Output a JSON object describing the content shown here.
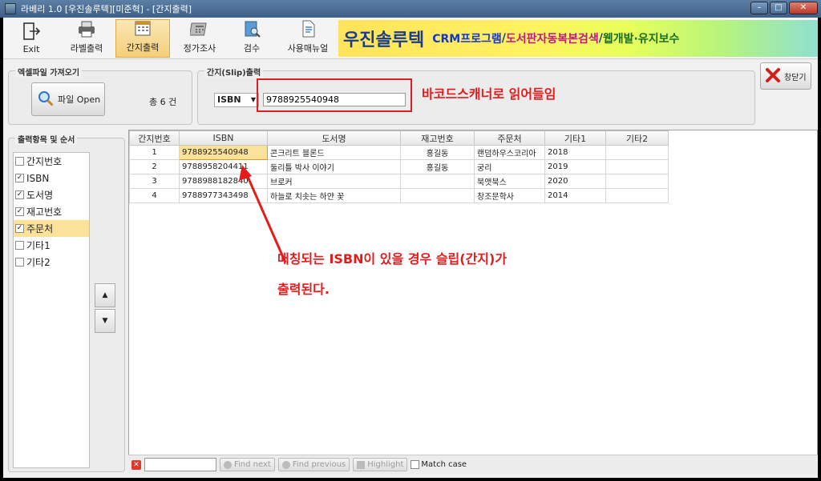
{
  "window": {
    "title": "라베리 1.0 [우진솔루텍][미준혁] - [간지출력]",
    "min_label": "–",
    "max_label": "□",
    "close_label": "✕"
  },
  "toolbar": {
    "exit": "Exit",
    "label_print": "라벨출력",
    "slip_print": "간지출력",
    "price_check": "정가조사",
    "inspect": "검수",
    "manual": "사용매뉴얼"
  },
  "banner": {
    "company": "우진솔루텍",
    "crm": "CRM프로그램",
    "sep1": "/",
    "search": "도서판자동복본검색",
    "sep2": "/",
    "web": "웹개발·유지보수"
  },
  "excel_group": {
    "legend": "엑셀파일 가져오기",
    "open_label": "파일 Open",
    "total": "총 6 건"
  },
  "slip_group": {
    "legend": "간지(Slip)출력",
    "select_value": "ISBN",
    "barcode_value": "9788925540948"
  },
  "close_button": "창닫기",
  "annotations": {
    "scanner": "바코드스캐너로 읽어들임",
    "matching_line1": "매칭되는 ISBN이 있을 경우 슬립(간지)가",
    "matching_line2": "출력된다."
  },
  "output_order": {
    "legend": "출력항목 및 순서",
    "items": [
      {
        "label": "간지번호",
        "checked": ""
      },
      {
        "label": "ISBN",
        "checked": "✓"
      },
      {
        "label": "도서명",
        "checked": "✓"
      },
      {
        "label": "재고번호",
        "checked": "✓"
      },
      {
        "label": "주문처",
        "checked": "✓"
      },
      {
        "label": "기타1",
        "checked": ""
      },
      {
        "label": "기타2",
        "checked": ""
      }
    ],
    "up_label": "▲",
    "down_label": "▼"
  },
  "grid": {
    "columns": [
      "간지번호",
      "ISBN",
      "도서명",
      "재고번호",
      "주문처",
      "기타1",
      "기타2"
    ],
    "rows": [
      [
        "1",
        "9788925540948",
        "콘크리트 블론드",
        "홍길동",
        "랜덤하우스코리아",
        "2018",
        ""
      ],
      [
        "2",
        "9788958204411",
        "둘리틀 박사 이야기",
        "홍길동",
        "궁리",
        "2019",
        ""
      ],
      [
        "3",
        "9788988182840",
        "브로커",
        "",
        "북앳북스",
        "2020",
        ""
      ],
      [
        "4",
        "9788977343498",
        "하늘로 치솟는 하얀 꽃",
        "",
        "창조문학사",
        "2014",
        ""
      ]
    ]
  },
  "findbar": {
    "find_next": "Find next",
    "find_previous": "Find previous",
    "highlight": "Highlight",
    "match_case": "Match case"
  },
  "colors": {
    "accent_red": "#e51b1b",
    "selection": "#fbe29a"
  }
}
